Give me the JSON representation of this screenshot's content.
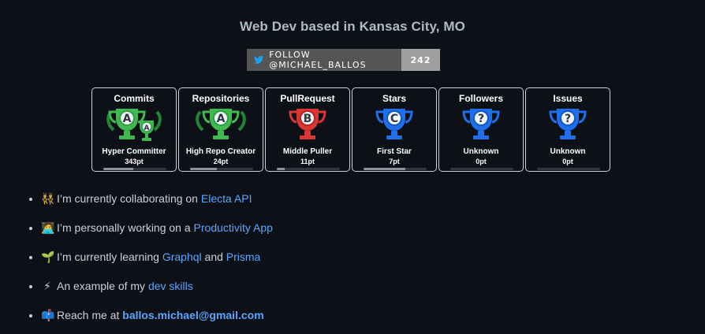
{
  "title": "Web Dev based in Kansas City, MO",
  "follow_badge": {
    "label": "FOLLOW @MICHAEL_BALLOS",
    "count": "242",
    "icon": "twitter-bird-icon",
    "left_color": "#555555",
    "right_color": "#9f9f9f",
    "icon_color": "#1da1f2"
  },
  "trophies": [
    {
      "category": "Commits",
      "rank": "A",
      "secondary_rank": "A",
      "name": "Hyper Committer",
      "points": "343pt",
      "progress": 0.48,
      "color": "#3fb950"
    },
    {
      "category": "Repositories",
      "rank": "A",
      "name": "High Repo Creator",
      "points": "24pt",
      "progress": 0.42,
      "color": "#3fb950"
    },
    {
      "category": "PullRequest",
      "rank": "B",
      "name": "Middle Puller",
      "points": "11pt",
      "progress": 0.12,
      "color": "#da3633"
    },
    {
      "category": "Stars",
      "rank": "C",
      "name": "First Star",
      "points": "7pt",
      "progress": 0.66,
      "color": "#1f6feb"
    },
    {
      "category": "Followers",
      "rank": "?",
      "name": "Unknown",
      "points": "0pt",
      "progress": 0.0,
      "color": "#1f6feb"
    },
    {
      "category": "Issues",
      "rank": "?",
      "name": "Unknown",
      "points": "0pt",
      "progress": 0.0,
      "color": "#1f6feb"
    }
  ],
  "list": [
    {
      "emoji": "👯",
      "text": "I’m currently collaborating on ",
      "link": "Electa API"
    },
    {
      "emoji": "🧑‍💻",
      "text": "I’m personally working on a ",
      "link": "Productivity App"
    },
    {
      "emoji": "🌱",
      "text": "I’m currently learning ",
      "link": "Graphql",
      "middle": " and ",
      "link2": "Prisma"
    },
    {
      "emoji": "⚡",
      "text": "An example of my ",
      "link": "dev skills"
    },
    {
      "emoji": "📫",
      "text": "Reach me at ",
      "link": "ballos.michael@gmail.com"
    }
  ]
}
